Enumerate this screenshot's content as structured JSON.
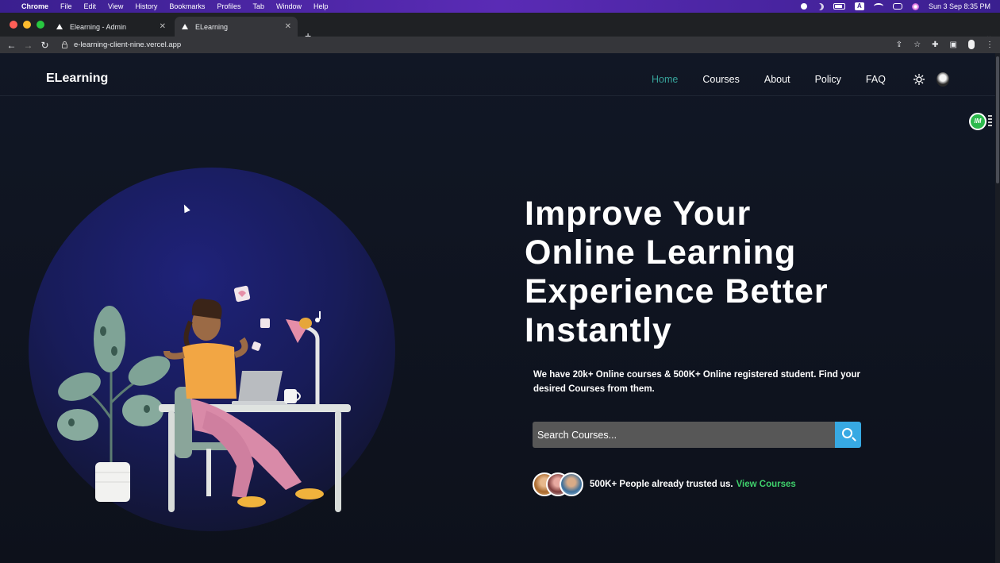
{
  "menubar": {
    "app": "Chrome",
    "items": [
      "File",
      "Edit",
      "View",
      "History",
      "Bookmarks",
      "Profiles",
      "Tab",
      "Window",
      "Help"
    ],
    "clock": "Sun 3 Sep  8:35 PM",
    "input_source": "A"
  },
  "browser": {
    "tabs": [
      {
        "title": "Elearning - Admin"
      },
      {
        "title": "ELearning"
      }
    ],
    "url": "e-learning-client-nine.vercel.app"
  },
  "site": {
    "logo": "ELearning",
    "nav": [
      "Home",
      "Courses",
      "About",
      "Policy",
      "FAQ"
    ],
    "active_nav": "Home",
    "accent_color": "#37a39a"
  },
  "extension_badge": "IM",
  "hero": {
    "headline": "Improve Your Online Learning Experience Better Instantly",
    "subtext": "We have 20k+ Online courses & 500K+ Online registered student. Find your desired Courses from them.",
    "search_placeholder": "Search Courses...",
    "trust_text": "500K+ People already trusted us.",
    "trust_link": "View Courses",
    "link_color": "#3fd06b",
    "search_button_color": "#37a9e3"
  }
}
